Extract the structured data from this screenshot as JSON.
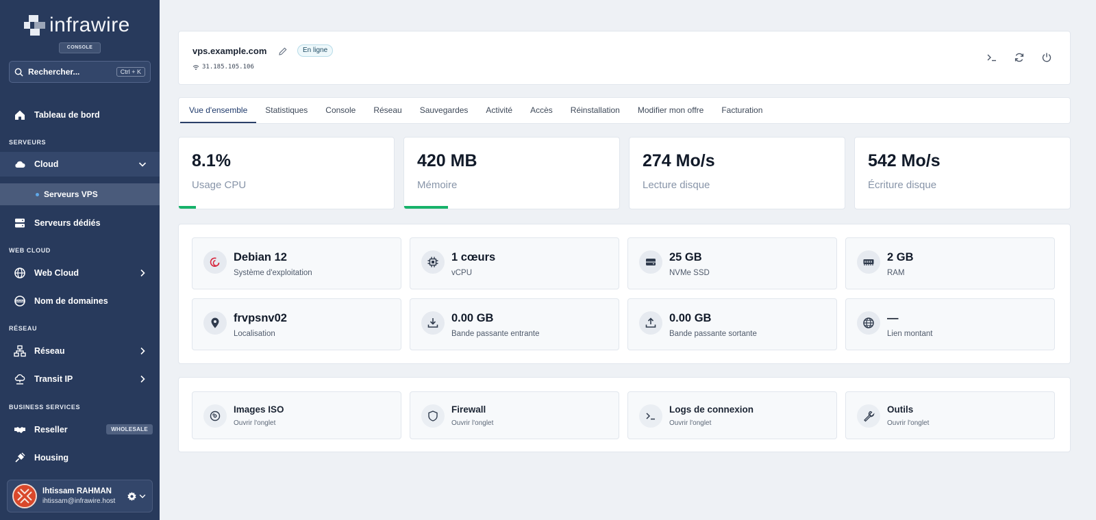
{
  "brand": {
    "name": "infrawire",
    "badge": "CONSOLE"
  },
  "search": {
    "placeholder": "Rechercher...",
    "shortcut": "Ctrl + K"
  },
  "sidebar": {
    "dashboard": "Tableau de bord",
    "sections": {
      "servers": "SERVEURS",
      "webcloud": "WEB CLOUD",
      "network": "RÉSEAU",
      "business": "BUSINESS SERVICES"
    },
    "cloud": "Cloud",
    "vps": "Serveurs VPS",
    "dedicated": "Serveurs dédiés",
    "web_cloud": "Web Cloud",
    "domains": "Nom de domaines",
    "network": "Réseau",
    "transit": "Transit IP",
    "reseller": "Reseller",
    "reseller_badge": "WHOLESALE",
    "housing": "Housing"
  },
  "user": {
    "name": "Ihtissam RAHMAN",
    "email": "ihtissam@infrawire.host"
  },
  "server": {
    "hostname": "vps.example.com",
    "status": "En ligne",
    "ip": "31.185.105.106"
  },
  "tabs": [
    "Vue d'ensemble",
    "Statistiques",
    "Console",
    "Réseau",
    "Sauvegardes",
    "Activité",
    "Accès",
    "Réinstallation",
    "Modifier mon offre",
    "Facturation"
  ],
  "metrics": [
    {
      "value": "8.1%",
      "label": "Usage CPU",
      "usage": 0.081
    },
    {
      "value": "420 MB",
      "label": "Mémoire",
      "usage": 0.205
    },
    {
      "value": "274 Mo/s",
      "label": "Lecture disque",
      "usage": 0
    },
    {
      "value": "542 Mo/s",
      "label": "Écriture disque",
      "usage": 0
    }
  ],
  "specs": [
    {
      "value": "Debian 12",
      "label": "Système d'exploitation",
      "icon": "debian-icon"
    },
    {
      "value": "1 cœurs",
      "label": "vCPU",
      "icon": "cpu-icon"
    },
    {
      "value": "25 GB",
      "label": "NVMe SSD",
      "icon": "disk-icon"
    },
    {
      "value": "2 GB",
      "label": "RAM",
      "icon": "ram-icon"
    },
    {
      "value": "frvpsnv02",
      "label": "Localisation",
      "icon": "location-pin-icon"
    },
    {
      "value": "0.00 GB",
      "label": "Bande passante entrante",
      "icon": "download-icon"
    },
    {
      "value": "0.00 GB",
      "label": "Bande passante sortante",
      "icon": "upload-icon"
    },
    {
      "value": "—",
      "label": "Lien montant",
      "icon": "globe-icon"
    }
  ],
  "tools": [
    {
      "title": "Images ISO",
      "subtitle": "Ouvrir l'onglet",
      "icon": "disc-icon"
    },
    {
      "title": "Firewall",
      "subtitle": "Ouvrir l'onglet",
      "icon": "shield-icon"
    },
    {
      "title": "Logs de connexion",
      "subtitle": "Ouvrir l'onglet",
      "icon": "terminal-icon"
    },
    {
      "title": "Outils",
      "subtitle": "Ouvrir l'onglet",
      "icon": "wrench-icon"
    }
  ],
  "colors": {
    "sidebar": "#283a5c",
    "accent_bar": "#17b26a",
    "tab_active": "#2a3f67"
  }
}
